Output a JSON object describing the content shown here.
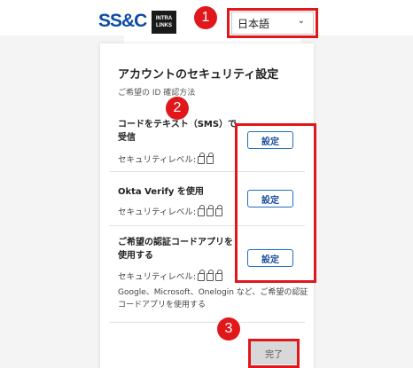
{
  "header": {
    "brand": "SS&C",
    "intralinks_line1": "INTRA",
    "intralinks_line2": "LINKS",
    "language_value": "日本語"
  },
  "markers": [
    "1",
    "2",
    "3"
  ],
  "card": {
    "title": "アカウントのセキュリティ設定",
    "subtitle": "ご希望の ID 確認方法",
    "security_level_label": "セキュリティレベル:",
    "options": [
      {
        "title": "コードをテキスト（SMS）で受信",
        "button": "設定",
        "locks": 2
      },
      {
        "title": "Okta Verify を使用",
        "button": "設定",
        "locks": 3
      },
      {
        "title": "ご希望の認証コードアプリを使用する",
        "button": "設定",
        "locks": 3
      }
    ],
    "authenticator_note": "Google、Microsoft、Onelogin など、ご希望の認証コードアプリを使用する",
    "done_button": "完了"
  },
  "colors": {
    "highlight": "#e0171b",
    "brand_blue": "#0d4da1",
    "button_border": "#1d6fc4"
  },
  "icons": {
    "language_chevron": "chevron-down-icon",
    "security_level": "lock-icon"
  }
}
